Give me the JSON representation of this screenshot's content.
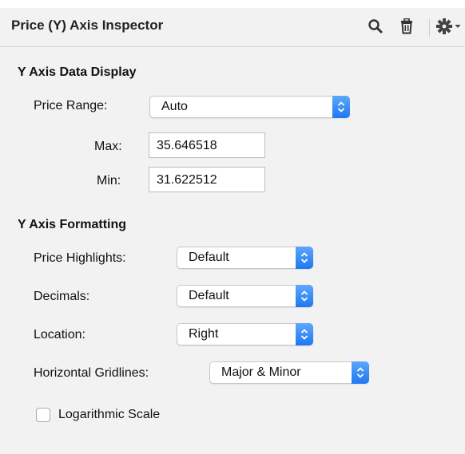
{
  "header": {
    "title": "Price (Y) Axis Inspector",
    "icons": [
      "search-icon",
      "trash-icon",
      "gear-icon",
      "chevron-down-icon"
    ]
  },
  "y_axis_data_display": {
    "heading": "Y Axis Data Display",
    "price_range_label": "Price Range:",
    "price_range_value": "Auto",
    "max_label": "Max:",
    "max_value": "35.646518",
    "min_label": "Min:",
    "min_value": "31.622512"
  },
  "y_axis_formatting": {
    "heading": "Y Axis Formatting",
    "price_highlights_label": "Price Highlights:",
    "price_highlights_value": "Default",
    "decimals_label": "Decimals:",
    "decimals_value": "Default",
    "location_label": "Location:",
    "location_value": "Right",
    "gridlines_label": "Horizontal Gridlines:",
    "gridlines_value": "Major & Minor",
    "log_scale_label": "Logarithmic Scale",
    "log_scale_checked": false
  },
  "colors": {
    "accent": "#1e78f0",
    "panel_bg": "#f2f2f2"
  }
}
